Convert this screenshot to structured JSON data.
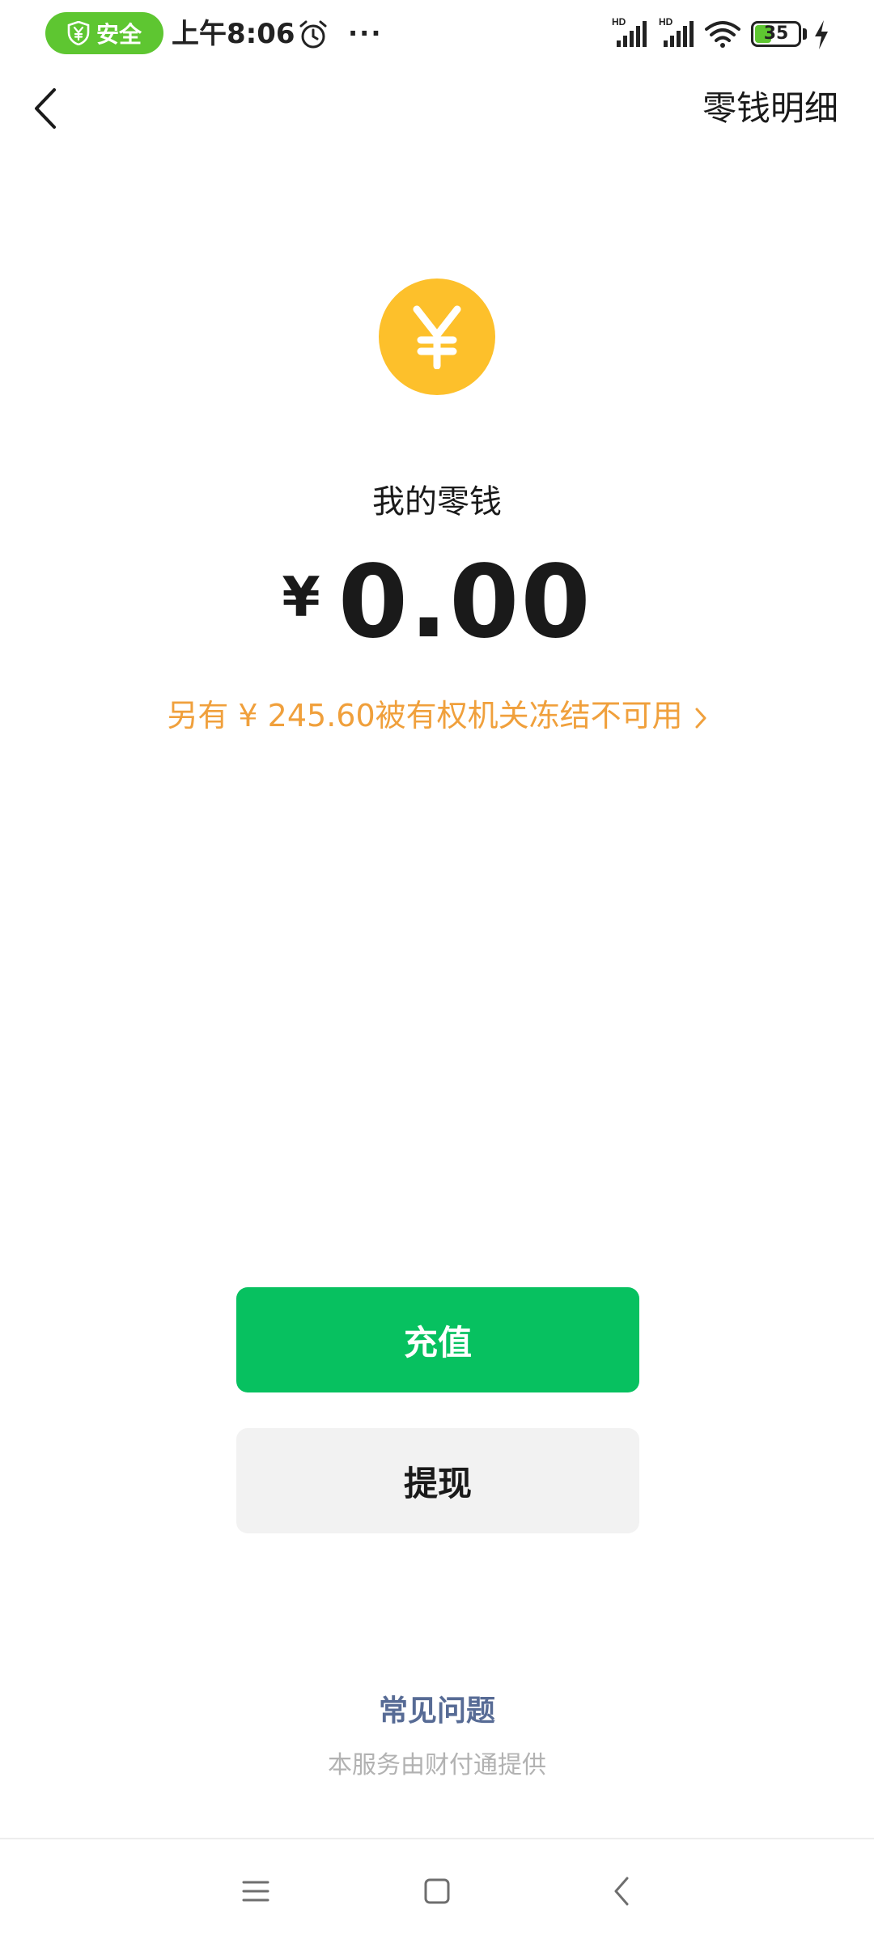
{
  "status_bar": {
    "security_label": "安全",
    "time": "上午8:06",
    "more": "···",
    "signal_1_label": "HD",
    "signal_2_label": "HD",
    "battery_level": "35",
    "battery_fraction": 0.35,
    "icons": [
      "shield-yuan-icon",
      "alarm-icon",
      "signal-icon",
      "wifi-icon",
      "battery-icon",
      "charging-icon"
    ]
  },
  "header": {
    "back_icon": "chevron-left-icon",
    "detail_link": "零钱明细"
  },
  "balance": {
    "coin_icon": "yuan-coin-icon",
    "coin_symbol": "¥",
    "label": "我的零钱",
    "currency": "¥",
    "amount": "0.00",
    "frozen_notice": "另有 ¥ 245.60被有权机关冻结不可用",
    "frozen_icon": "chevron-right-icon"
  },
  "actions": {
    "recharge_label": "充值",
    "withdraw_label": "提现"
  },
  "footer": {
    "faq_label": "常见问题",
    "provider_text": "本服务由财付通提供"
  },
  "system_nav": {
    "icons": [
      "menu-icon",
      "home-icon",
      "back-icon"
    ]
  },
  "colors": {
    "security_green": "#5ec631",
    "coin_yellow": "#fdc02b",
    "frozen_orange": "#f0a03c",
    "primary_green": "#07c160",
    "secondary_gray": "#f2f2f2",
    "link_blue": "#576b95",
    "muted_gray": "#b2b2b2"
  }
}
